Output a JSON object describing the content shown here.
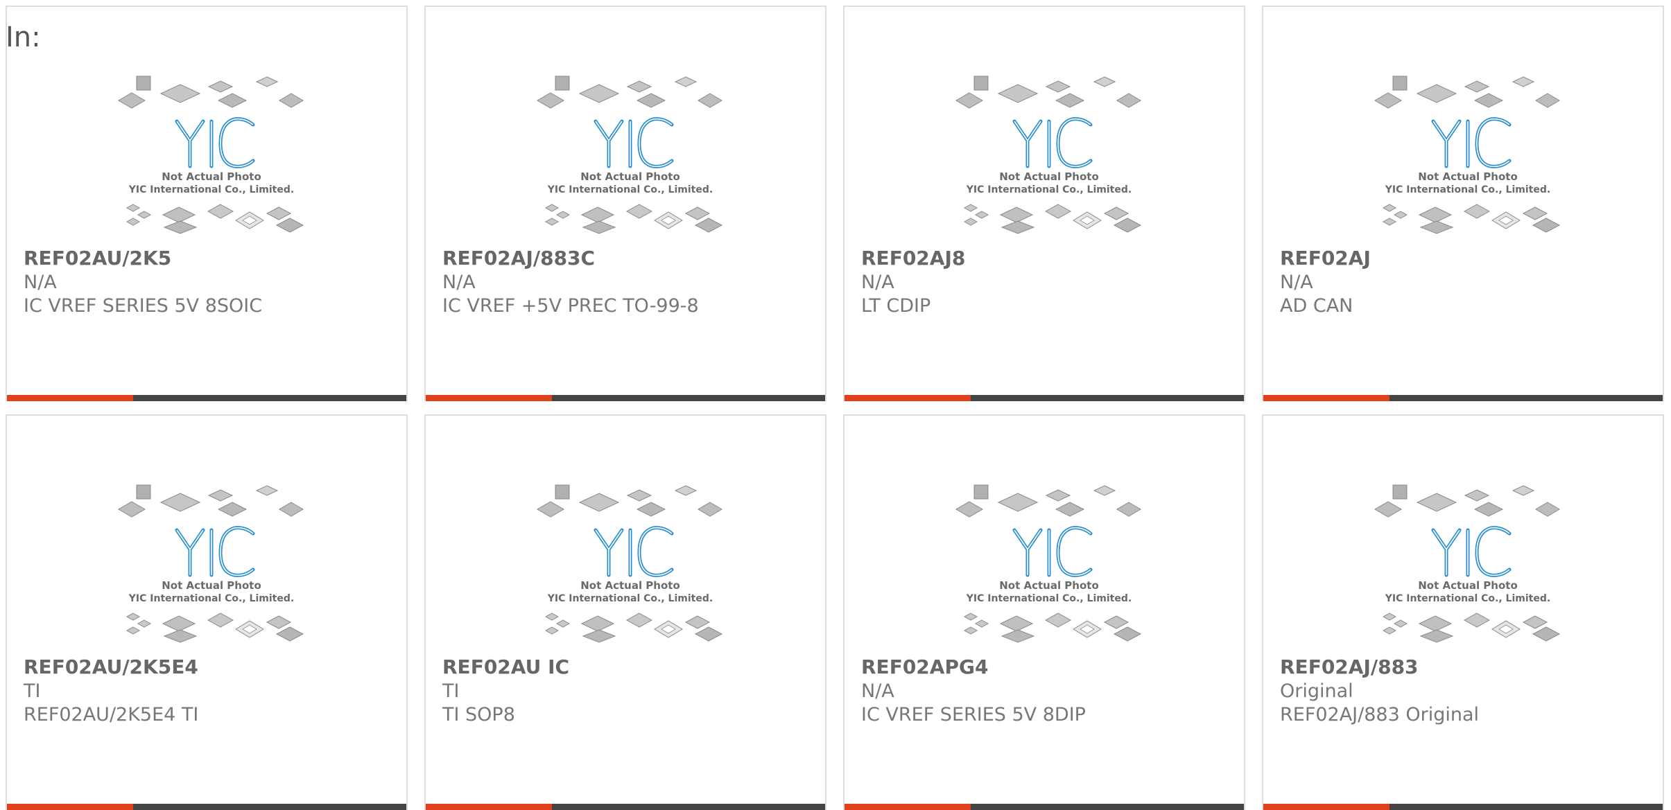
{
  "header": {
    "in_label": "In:"
  },
  "photo": {
    "logo_text": "YIC",
    "caption_line1": "Not Actual Photo",
    "caption_line2": "YIC International Co., Limited."
  },
  "colors": {
    "accent": "#e0401c",
    "bar": "#444444",
    "border": "#dcdcdc",
    "logo": "#2a8fd0"
  },
  "products": [
    {
      "part": "REF02AU/2K5",
      "manufacturer": "N/A",
      "description": "IC VREF SERIES 5V 8SOIC"
    },
    {
      "part": "REF02AJ/883C",
      "manufacturer": "N/A",
      "description": "IC VREF +5V PREC TO-99-8"
    },
    {
      "part": "REF02AJ8",
      "manufacturer": "N/A",
      "description": "LT CDIP"
    },
    {
      "part": "REF02AJ",
      "manufacturer": "N/A",
      "description": "AD CAN"
    },
    {
      "part": "REF02AU/2K5E4",
      "manufacturer": "TI",
      "description": "REF02AU/2K5E4 TI"
    },
    {
      "part": "REF02AU IC",
      "manufacturer": "TI",
      "description": "TI SOP8"
    },
    {
      "part": "REF02APG4",
      "manufacturer": "N/A",
      "description": "IC VREF SERIES 5V 8DIP"
    },
    {
      "part": "REF02AJ/883",
      "manufacturer": "Original",
      "description": "REF02AJ/883 Original"
    }
  ]
}
